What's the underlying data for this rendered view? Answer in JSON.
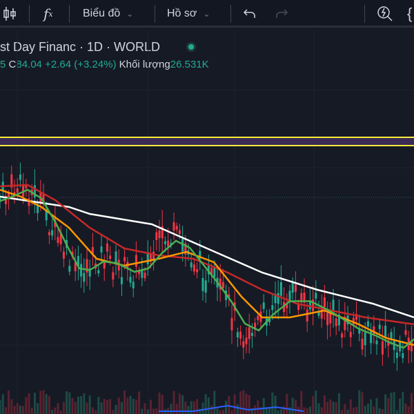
{
  "toolbar": {
    "candle_icon": "candles-icon",
    "indicator_icon": "fx-icon",
    "chart_menu": "Biểu đồ",
    "profile_menu": "Hồ sơ",
    "undo_icon": "undo-icon",
    "redo_icon": "redo-icon",
    "alert_icon": "quick-search-icon"
  },
  "legend": {
    "title": "st Day Financ · 1D · WORLD",
    "partial_prefix": "5",
    "close_label": "C",
    "close": "84.04",
    "change": "+2.64 (+3.24%)",
    "volume_label": "Khối lượng",
    "volume": "26.531K"
  },
  "colors": {
    "up": "#22ab94",
    "down": "#f23645",
    "ma_short": "#4caf50",
    "ma_mid": "#ff9800",
    "ma_long": "#c62828",
    "ma_200": "#ffffff",
    "hline": "#ffeb3b"
  }
}
